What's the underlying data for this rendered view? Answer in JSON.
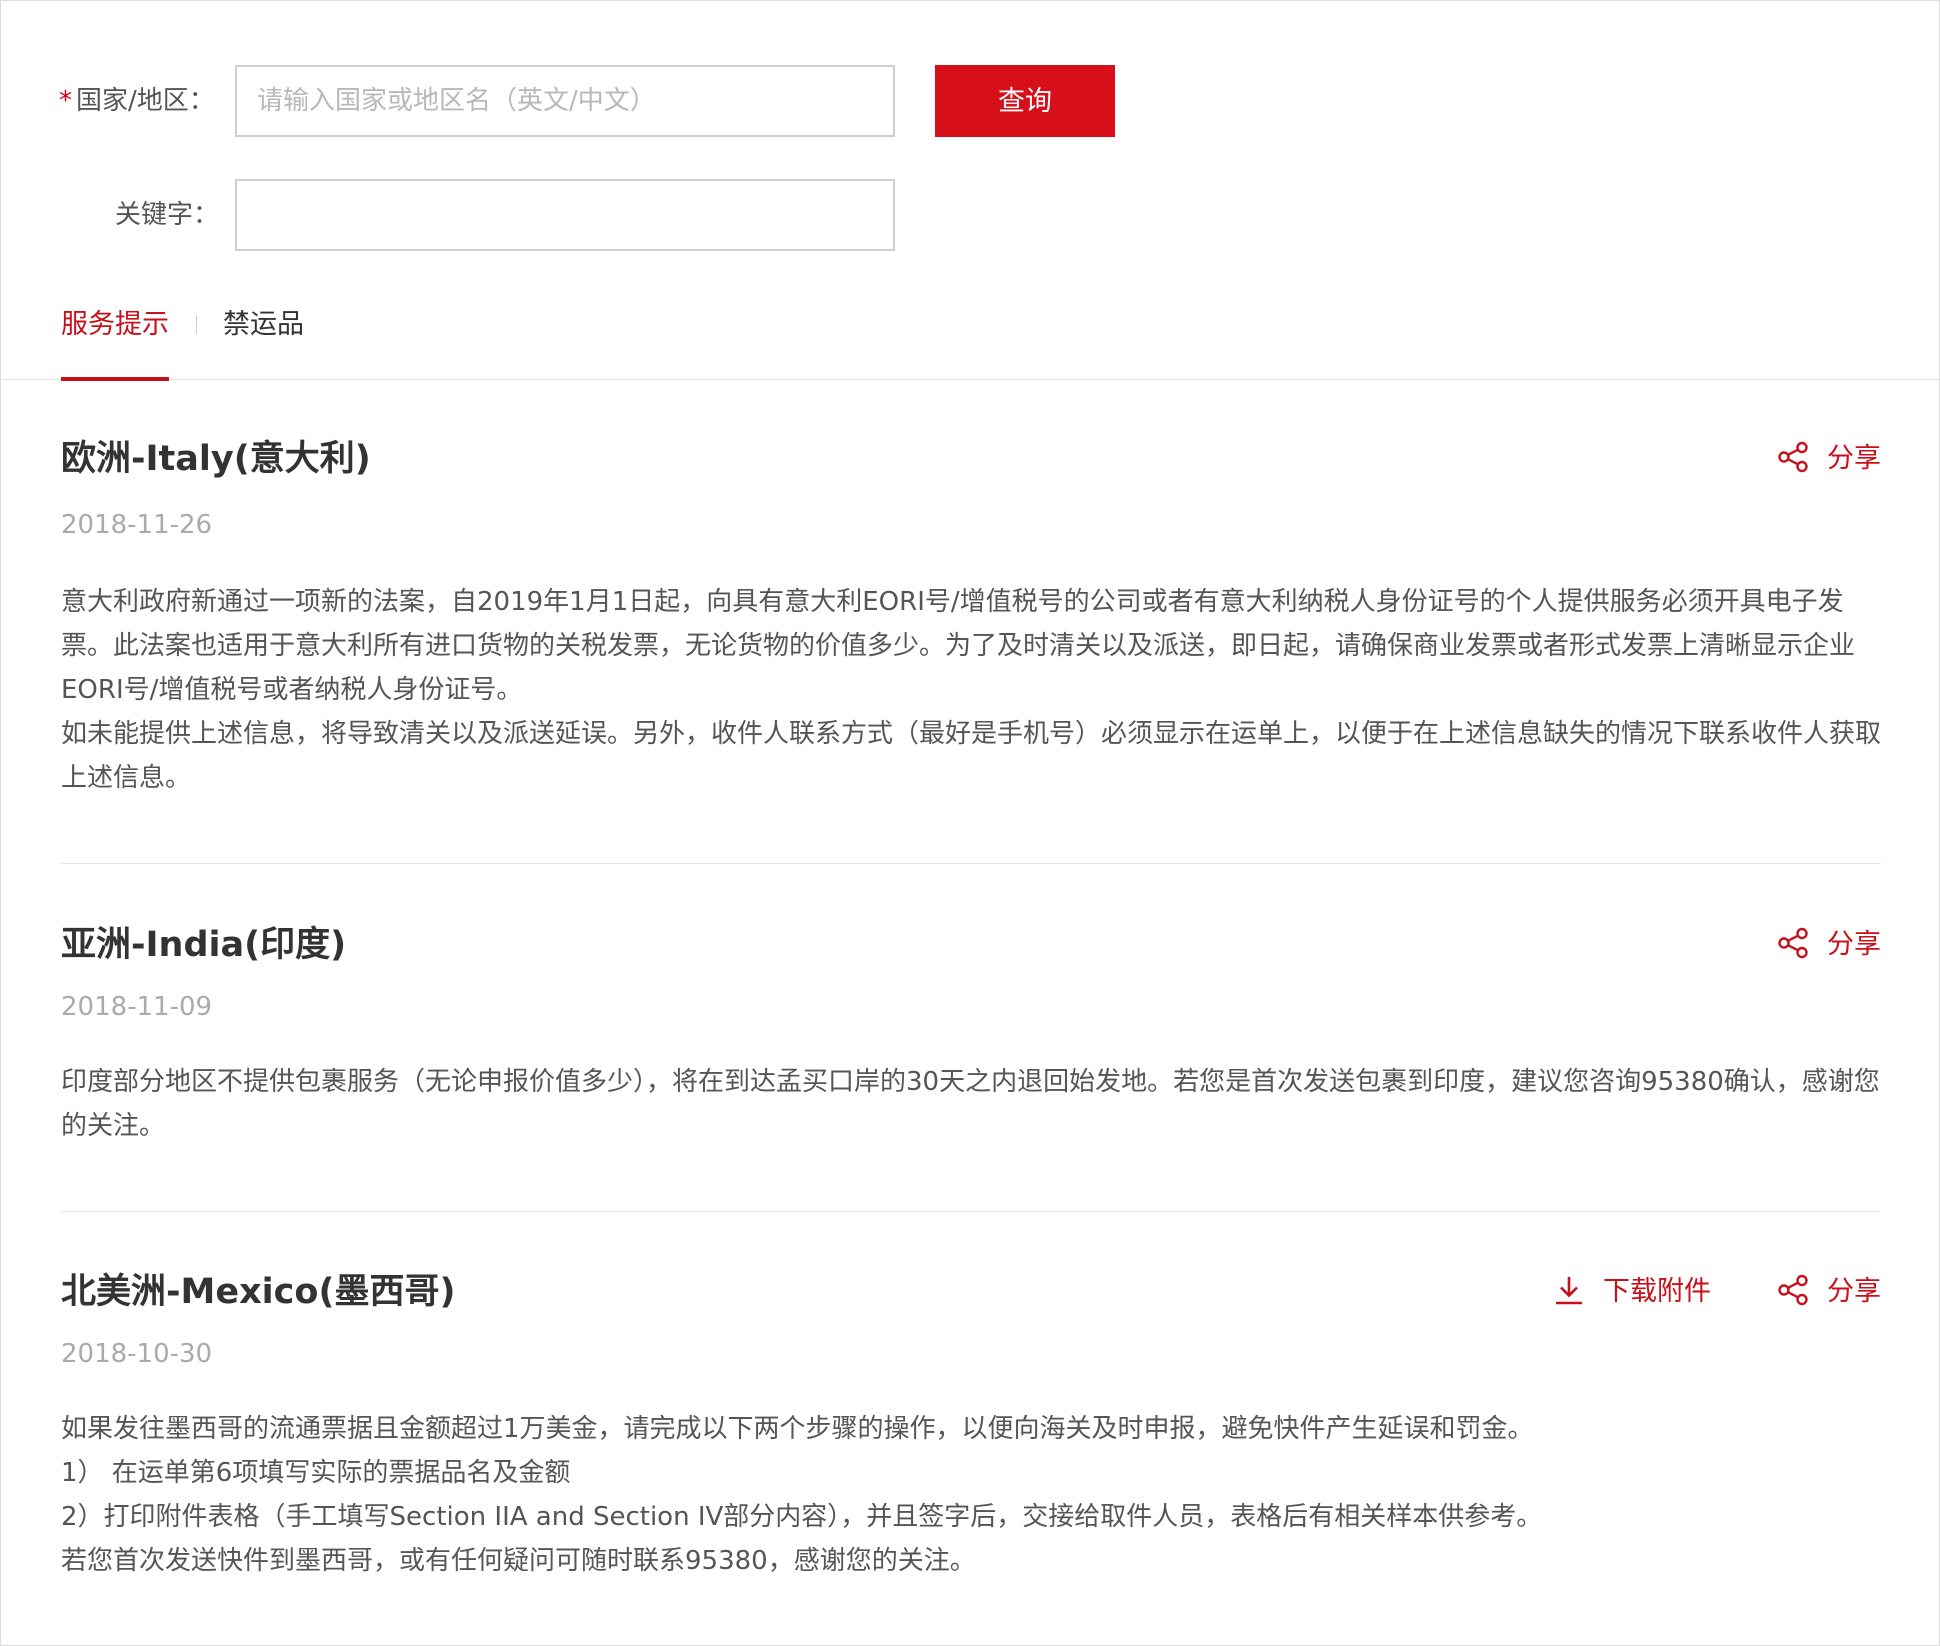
{
  "search_form": {
    "country_label": "国家/地区：",
    "required_mark": "*",
    "country_placeholder": "请输入国家或地区名（英文/中文）",
    "country_value": "",
    "keyword_label": "关键字：",
    "keyword_value": "",
    "query_button": "查询"
  },
  "tabs": [
    {
      "label": "服务提示",
      "active": true
    },
    {
      "label": "禁运品",
      "active": false
    }
  ],
  "articles": [
    {
      "title": "欧洲-Italy(意大利)",
      "date": "2018-11-26",
      "share_label": "分享",
      "paragraphs": [
        "意大利政府新通过一项新的法案，自2019年1月1日起，向具有意大利EORI号/增值税号的公司或者有意大利纳税人身份证号的个人提供服务必须开具电子发票。此法案也适用于意大利所有进口货物的关税发票，无论货物的价值多少。为了及时清关以及派送，即日起，请确保商业发票或者形式发票上清晰显示企业EORI号/增值税号或者纳税人身份证号。",
        "如未能提供上述信息，将导致清关以及派送延误。另外，收件人联系方式（最好是手机号）必须显示在运单上，以便于在上述信息缺失的情况下联系收件人获取上述信息。"
      ]
    },
    {
      "title": "亚洲-India(印度)",
      "date": "2018-11-09",
      "share_label": "分享",
      "paragraphs": [
        "印度部分地区不提供包裹服务（无论申报价值多少），将在到达孟买口岸的30天之内退回始发地。若您是首次发送包裹到印度，建议您咨询95380确认，感谢您的关注。"
      ]
    },
    {
      "title": "北美洲-Mexico(墨西哥)",
      "date": "2018-10-30",
      "share_label": "分享",
      "download_label": "下载附件",
      "paragraphs": [
        "如果发往墨西哥的流通票据且金额超过1万美金，请完成以下两个步骤的操作，以便向海关及时申报，避免快件产生延误和罚金。",
        "1）  在运单第6项填写实际的票据品名及金额",
        "2）打印附件表格（手工填写Section IIA and Section IV部分内容），并且签字后，交接给取件人员，表格后有相关样本供参考。",
        "若您首次发送快件到墨西哥，或有任何疑问可随时联系95380，感谢您的关注。"
      ]
    }
  ],
  "icons": {
    "share": "share-icon",
    "download": "download-icon"
  },
  "colors": {
    "accent": "#c8101a",
    "button": "#d60f19",
    "date": "#aaaaaa",
    "body_text": "#555555"
  }
}
